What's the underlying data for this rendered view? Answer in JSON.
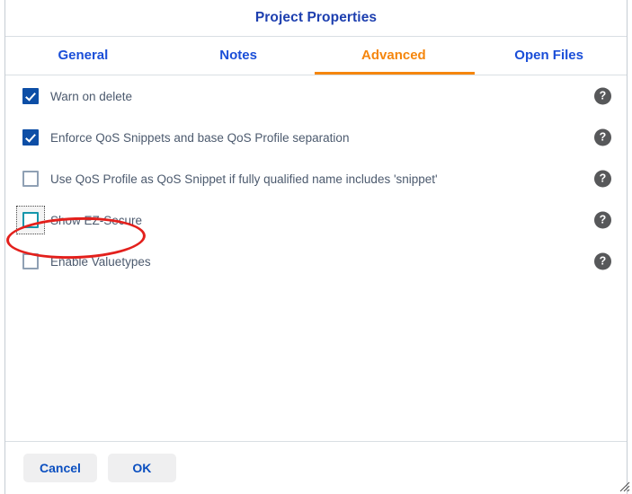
{
  "dialog": {
    "title": "Project Properties"
  },
  "tabs": [
    {
      "label": "General",
      "active": false
    },
    {
      "label": "Notes",
      "active": false
    },
    {
      "label": "Advanced",
      "active": true
    },
    {
      "label": "Open Files",
      "active": false
    }
  ],
  "options": [
    {
      "label": "Warn on delete",
      "checked": true,
      "focused": false,
      "help": "?"
    },
    {
      "label": "Enforce QoS Snippets and base QoS Profile separation",
      "checked": true,
      "focused": false,
      "help": "?"
    },
    {
      "label": "Use QoS Profile as QoS Snippet if fully qualified name includes 'snippet'",
      "checked": false,
      "focused": false,
      "help": "?"
    },
    {
      "label": "Show EZ-Secure",
      "checked": false,
      "focused": true,
      "help": "?"
    },
    {
      "label": "Enable Valuetypes",
      "checked": false,
      "focused": false,
      "help": "?"
    }
  ],
  "footer": {
    "cancel_label": "Cancel",
    "ok_label": "OK"
  },
  "annotation": {
    "shape": "ellipse",
    "color": "#e3201c",
    "target": "Show EZ-Secure"
  },
  "colors": {
    "title_blue": "#1d3faf",
    "tab_blue": "#1a4ed8",
    "active_tab_orange": "#f5860d",
    "checkbox_blue": "#0d4ea6",
    "checkbox_focus_teal": "#1596ab",
    "label_gray": "#4c5a6e",
    "help_icon_gray": "#57585a",
    "button_bg": "#efeff0",
    "button_text": "#0b4fc0",
    "annotation_red": "#e3201c",
    "separator": "#d9dfe3"
  }
}
